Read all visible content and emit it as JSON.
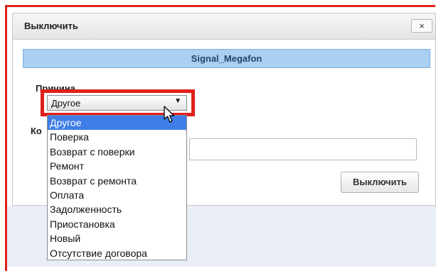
{
  "dialog": {
    "title": "Выключить",
    "close_label": "×",
    "device_name": "Signal_Megafon",
    "reason_label": "Причина",
    "comment_label": "Ко",
    "comment_value": "",
    "submit_label": "Выключить"
  },
  "reason_select": {
    "selected": "Другое",
    "options": [
      "Другое",
      "Поверка",
      "Возврат с поверки",
      "Ремонт",
      "Возврат с ремонта",
      "Оплата",
      "Задолженность",
      "Приостановка",
      "Новый",
      "Отсутствие договора"
    ]
  },
  "colors": {
    "highlight": "#e0201c",
    "banner": "#a9cff2",
    "option_selected": "#3f7de7"
  }
}
